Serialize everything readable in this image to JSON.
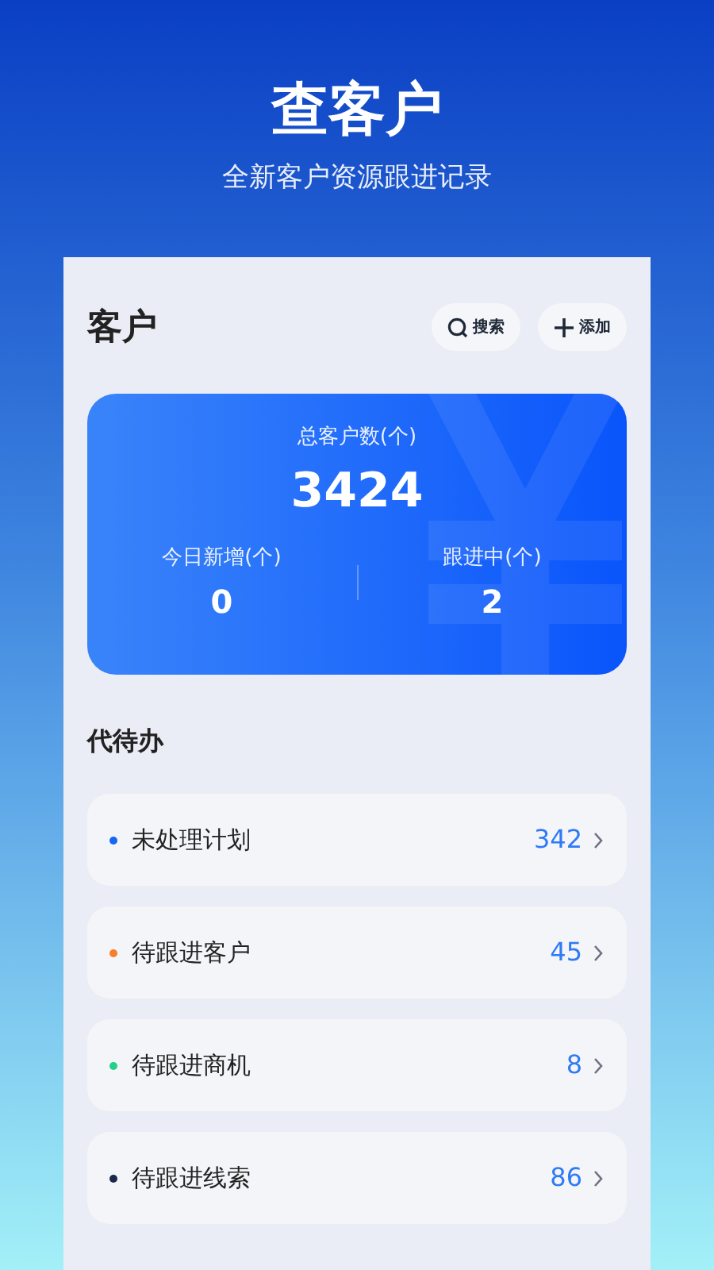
{
  "banner": {
    "title": "查客户",
    "subtitle": "全新客户资源跟进记录"
  },
  "header": {
    "title": "客户",
    "buttons": [
      {
        "kind": "search",
        "label": "搜索"
      },
      {
        "kind": "add",
        "label": "添加"
      }
    ]
  },
  "summary": {
    "total_label": "总客户数(个)",
    "total": "3424",
    "stats": [
      {
        "label": "今日新增(个)",
        "value": "0"
      },
      {
        "label": "跟进中(个)",
        "value": "2"
      }
    ]
  },
  "todo": {
    "title": "代待办",
    "items": [
      {
        "label": "未处理计划",
        "count": "342",
        "color": "#1765f5"
      },
      {
        "label": "待跟进客户",
        "count": "45",
        "color": "#f97e2b"
      },
      {
        "label": "待跟进商机",
        "count": "8",
        "color": "#22d08a"
      },
      {
        "label": "待跟进线索",
        "count": "86",
        "color": "#1c2a4a"
      }
    ]
  }
}
